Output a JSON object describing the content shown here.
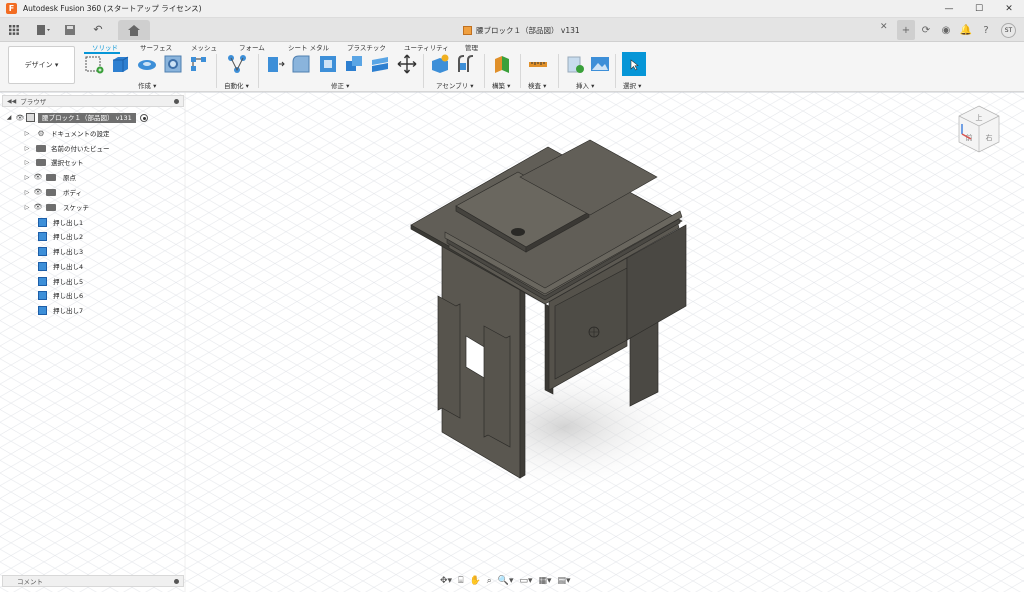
{
  "title_bar": {
    "app_title": "Autodesk Fusion 360 (スタートアップ ライセンス)",
    "window_buttons": [
      "—",
      "☐",
      "✕"
    ]
  },
  "quick_access": {
    "document_tab": "腰ブロック１（部品図） v131",
    "user_initials": "ST"
  },
  "ribbon": {
    "workspace": "デザイン ▾",
    "tabs": [
      "ソリッド",
      "サーフェス",
      "メッシュ",
      "フォーム",
      "シート メタル",
      "プラスチック",
      "ユーティリティ",
      "管理"
    ],
    "active_tab": "ソリッド",
    "groups": [
      "作成 ▾",
      "自動化 ▾",
      "修正 ▾",
      "アセンブリ ▾",
      "構築 ▾",
      "検査 ▾",
      "挿入 ▾",
      "選択 ▾"
    ],
    "colors": {
      "accent": "#0696d7",
      "select_fill": "#0696d7"
    }
  },
  "browser": {
    "header": "ブラウザ",
    "root_label": "腰ブロック１（部品図） v131",
    "items": [
      {
        "label": "ドキュメントの設定",
        "icon": "gear-icon",
        "eye": false
      },
      {
        "label": "名前の付いたビュー",
        "icon": "folder-icon",
        "eye": false
      },
      {
        "label": "選択セット",
        "icon": "folder-icon",
        "eye": false
      },
      {
        "label": "原点",
        "icon": "folder-icon",
        "eye": true
      },
      {
        "label": "ボディ",
        "icon": "folder-icon",
        "eye": true
      },
      {
        "label": "スケッチ",
        "icon": "folder-icon",
        "eye": true
      }
    ],
    "features": [
      "押し出し1",
      "押し出し2",
      "押し出し3",
      "押し出し4",
      "押し出し5",
      "押し出し6",
      "押し出し7"
    ]
  },
  "comments": {
    "label": "コメント"
  }
}
